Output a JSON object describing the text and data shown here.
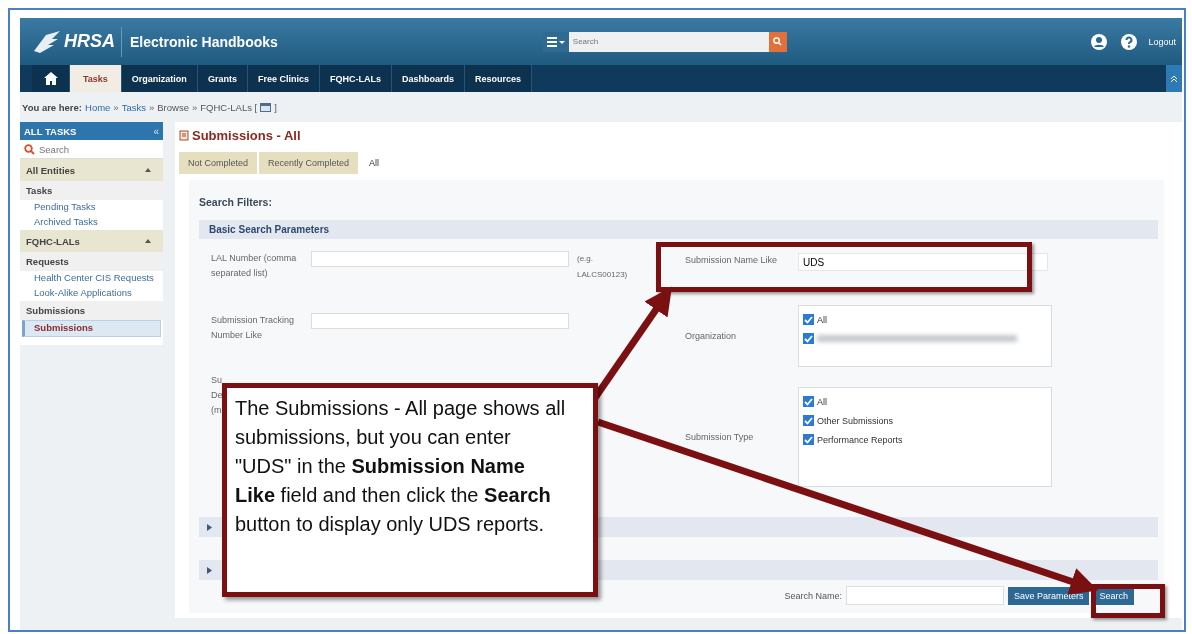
{
  "header": {
    "logo": "HRSA",
    "app_title": "Electronic Handbooks",
    "search": {
      "placeholder": "Search"
    },
    "logout": "Logout"
  },
  "nav": {
    "tabs": [
      {
        "label": "Tasks",
        "selected": true
      },
      {
        "label": "Organization",
        "selected": false
      },
      {
        "label": "Grants",
        "selected": false
      },
      {
        "label": "Free Clinics",
        "selected": false
      },
      {
        "label": "FQHC-LALs",
        "selected": false
      },
      {
        "label": "Dashboards",
        "selected": false
      },
      {
        "label": "Resources",
        "selected": false
      }
    ]
  },
  "breadcrumb": {
    "label": "You are here:",
    "separator": "»",
    "items": [
      {
        "text": "Home",
        "kind": "link"
      },
      {
        "text": "Tasks",
        "kind": "link"
      },
      {
        "text": "Browse",
        "kind": "plain"
      },
      {
        "text": "FQHC-LALs [",
        "kind": "plain"
      },
      {
        "text": "]",
        "kind": "plain"
      }
    ]
  },
  "sidebar": {
    "title": "ALL TASKS",
    "collapse": "«",
    "search": {
      "placeholder": "Search"
    },
    "groups": [
      {
        "title": "All Entities",
        "expanded": true,
        "sections": [
          {
            "title": "Tasks",
            "items": [
              {
                "label": "Pending Tasks",
                "selected": false
              },
              {
                "label": "Archived Tasks",
                "selected": false
              }
            ]
          }
        ]
      },
      {
        "title": "FQHC-LALs",
        "expanded": true,
        "sections": [
          {
            "title": "Requests",
            "items": [
              {
                "label": "Health Center CIS Requests",
                "selected": false
              },
              {
                "label": "Look-Alike Applications",
                "selected": false
              }
            ]
          },
          {
            "title": "Submissions",
            "items": [
              {
                "label": "Submissions",
                "selected": true
              }
            ]
          }
        ]
      }
    ]
  },
  "page": {
    "title": "Submissions - All",
    "tabs": [
      {
        "label": "Not Completed",
        "selected": false
      },
      {
        "label": "Recently Completed",
        "selected": false
      },
      {
        "label": "All",
        "selected": true
      }
    ]
  },
  "filters": {
    "heading": "Search Filters:",
    "section": "Basic Search Parameters",
    "left_fields": [
      {
        "label": "LAL Number (comma separated list)",
        "hint": "(e.g. LALCS00123)"
      },
      {
        "label": "Submission Tracking Number Like"
      }
    ],
    "hidden_label": "Su De (m",
    "right_fields": [
      {
        "label": "Submission Name Like",
        "kind": "text",
        "value": "UDS"
      },
      {
        "label": "Organization",
        "kind": "checklist",
        "options": [
          {
            "label": "All",
            "checked": true,
            "kind": "text"
          },
          {
            "checked": true,
            "kind": "redacted"
          }
        ]
      },
      {
        "label": "Submission Type",
        "kind": "checklist",
        "options": [
          {
            "label": "All",
            "checked": true,
            "kind": "text"
          },
          {
            "label": "Other Submissions",
            "checked": true,
            "kind": "text"
          },
          {
            "label": "Performance Reports",
            "checked": true,
            "kind": "text"
          }
        ]
      }
    ],
    "collapsed_sections": [
      {
        "expanded": false
      },
      {
        "expanded": false
      }
    ]
  },
  "actions": {
    "search_name_label": "Search Name:",
    "save": "Save Parameters",
    "search": "Search"
  },
  "callout": {
    "text": "The Submissions - All page shows all submissions, but you can enter \"UDS\" in the **Submission Name Like** field and then click the **Search** button to display only UDS reports."
  }
}
